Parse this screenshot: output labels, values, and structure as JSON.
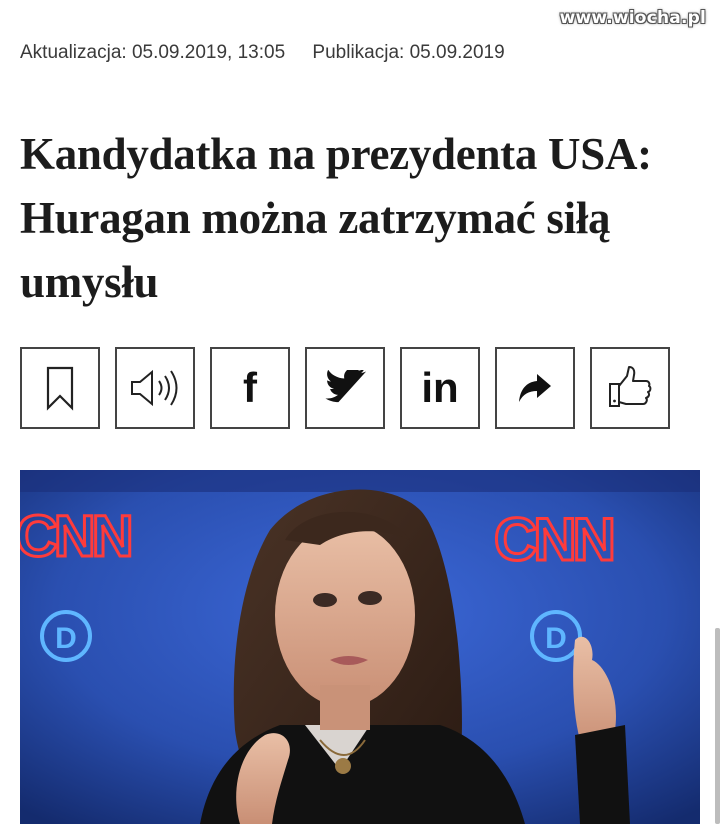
{
  "watermark": "www.wiocha.pl",
  "meta": {
    "updated": "Aktualizacja: 05.09.2019, 13:05",
    "published": "Publikacja: 05.09.2019"
  },
  "headline": "Kandydatka na prezydenta USA: Huragan można zatrzymać siłą umysłu",
  "toolbar": {
    "buttons": [
      {
        "name": "bookmark",
        "icon": "bookmark-icon"
      },
      {
        "name": "listen",
        "icon": "speaker-icon"
      },
      {
        "name": "facebook",
        "icon": "facebook-icon",
        "label": "f"
      },
      {
        "name": "twitter",
        "icon": "twitter-icon"
      },
      {
        "name": "linkedin",
        "icon": "linkedin-icon",
        "label": "in"
      },
      {
        "name": "share",
        "icon": "share-arrow-icon"
      },
      {
        "name": "like",
        "icon": "thumbs-up-icon"
      }
    ]
  },
  "photo": {
    "logo_left": "CNN",
    "logo_right": "CNN",
    "badge": "D"
  },
  "colors": {
    "stage_blue": "#2a4fb0",
    "cnn_red": "#e8242c",
    "text": "#1c1c1c",
    "meta": "#3a3a3a",
    "border": "#444444"
  }
}
